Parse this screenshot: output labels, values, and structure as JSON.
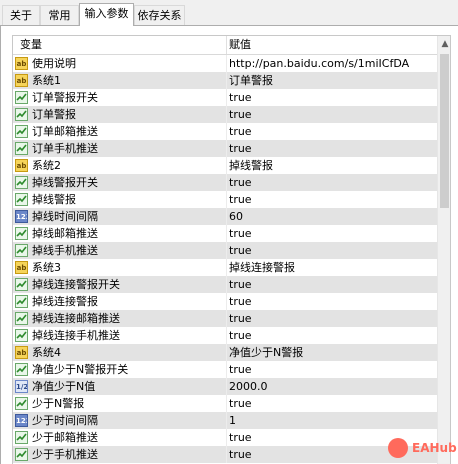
{
  "tabs": [
    {
      "label": "关于"
    },
    {
      "label": "常用"
    },
    {
      "label": "输入参数"
    },
    {
      "label": "依存关系"
    }
  ],
  "table": {
    "col_variable": "变量",
    "col_value": "赋值",
    "rows": [
      {
        "type": "ab",
        "icon": "string-type-icon",
        "name": "使用说明",
        "value": "http://pan.baidu.com/s/1miICfDA"
      },
      {
        "type": "ab",
        "icon": "string-type-icon",
        "name": "系统1",
        "value": "订单警报"
      },
      {
        "type": "bool",
        "icon": "bool-type-icon",
        "name": "订单警报开关",
        "value": "true"
      },
      {
        "type": "bool",
        "icon": "bool-type-icon",
        "name": "订单警报",
        "value": "true"
      },
      {
        "type": "bool",
        "icon": "bool-type-icon",
        "name": "订单邮箱推送",
        "value": "true"
      },
      {
        "type": "bool",
        "icon": "bool-type-icon",
        "name": "订单手机推送",
        "value": "true"
      },
      {
        "type": "ab",
        "icon": "string-type-icon",
        "name": "系统2",
        "value": "掉线警报"
      },
      {
        "type": "bool",
        "icon": "bool-type-icon",
        "name": "掉线警报开关",
        "value": "true"
      },
      {
        "type": "bool",
        "icon": "bool-type-icon",
        "name": "掉线警报",
        "value": "true"
      },
      {
        "type": "int",
        "icon": "int-type-icon",
        "name": "掉线时间间隔",
        "value": "60"
      },
      {
        "type": "bool",
        "icon": "bool-type-icon",
        "name": "掉线邮箱推送",
        "value": "true"
      },
      {
        "type": "bool",
        "icon": "bool-type-icon",
        "name": "掉线手机推送",
        "value": "true"
      },
      {
        "type": "ab",
        "icon": "string-type-icon",
        "name": "系统3",
        "value": "掉线连接警报"
      },
      {
        "type": "bool",
        "icon": "bool-type-icon",
        "name": "掉线连接警报开关",
        "value": "true"
      },
      {
        "type": "bool",
        "icon": "bool-type-icon",
        "name": "掉线连接警报",
        "value": "true"
      },
      {
        "type": "bool",
        "icon": "bool-type-icon",
        "name": "掉线连接邮箱推送",
        "value": "true"
      },
      {
        "type": "bool",
        "icon": "bool-type-icon",
        "name": "掉线连接手机推送",
        "value": "true"
      },
      {
        "type": "ab",
        "icon": "string-type-icon",
        "name": "系统4",
        "value": "净值少于N警报"
      },
      {
        "type": "bool",
        "icon": "bool-type-icon",
        "name": "净值少于N警报开关",
        "value": "true"
      },
      {
        "type": "dbl",
        "icon": "double-type-icon",
        "name": "净值少于N值",
        "value": "2000.0"
      },
      {
        "type": "bool",
        "icon": "bool-type-icon",
        "name": "少于N警报",
        "value": "true"
      },
      {
        "type": "int",
        "icon": "int-type-icon",
        "name": "少于时间间隔",
        "value": "1"
      },
      {
        "type": "bool",
        "icon": "bool-type-icon",
        "name": "少于邮箱推送",
        "value": "true"
      },
      {
        "type": "bool",
        "icon": "bool-type-icon",
        "name": "少于手机推送",
        "value": "true"
      }
    ]
  },
  "icon_labels": {
    "ab": "ab",
    "int": "123",
    "dbl": "1/2"
  },
  "watermark": {
    "text": "EAHub"
  },
  "colors": {
    "row_alt": "#e3e3e3",
    "watermark": "#ff6a5c"
  }
}
